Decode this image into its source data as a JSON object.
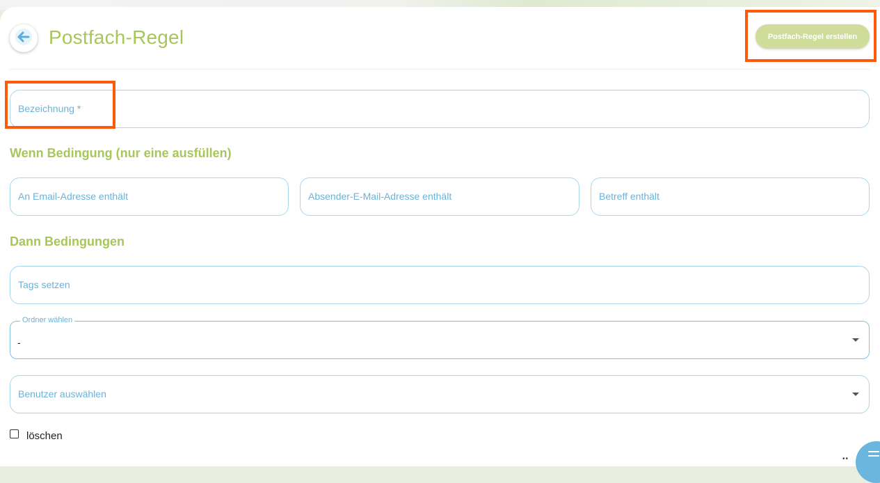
{
  "header": {
    "title": "Postfach-Regel",
    "create_button_label": "Postfach-Regel erstellen",
    "back_icon": "arrow-left-icon"
  },
  "form": {
    "name_field": {
      "placeholder": "Bezeichnung *",
      "value": ""
    },
    "condition_section": {
      "title": "Wenn Bedingung (nur eine ausfüllen)",
      "fields": [
        {
          "placeholder": "An Email-Adresse enthält",
          "value": ""
        },
        {
          "placeholder": "Absender-E-Mail-Adresse enthält",
          "value": ""
        },
        {
          "placeholder": "Betreff enthält",
          "value": ""
        }
      ]
    },
    "action_section": {
      "title": "Dann Bedingungen",
      "tags_field": {
        "placeholder": "Tags setzen",
        "value": ""
      },
      "folder_select": {
        "label": "Ordner wählen",
        "value": "-"
      },
      "user_select": {
        "placeholder": "Benutzer auswählen",
        "value": ""
      },
      "delete_checkbox": {
        "label": "löschen",
        "checked": false
      }
    }
  },
  "colors": {
    "accent_green": "#a9c65a",
    "button_green": "#cfdc9a",
    "field_blue": "#6ab3d8",
    "highlight_orange": "#ff5a0a"
  }
}
